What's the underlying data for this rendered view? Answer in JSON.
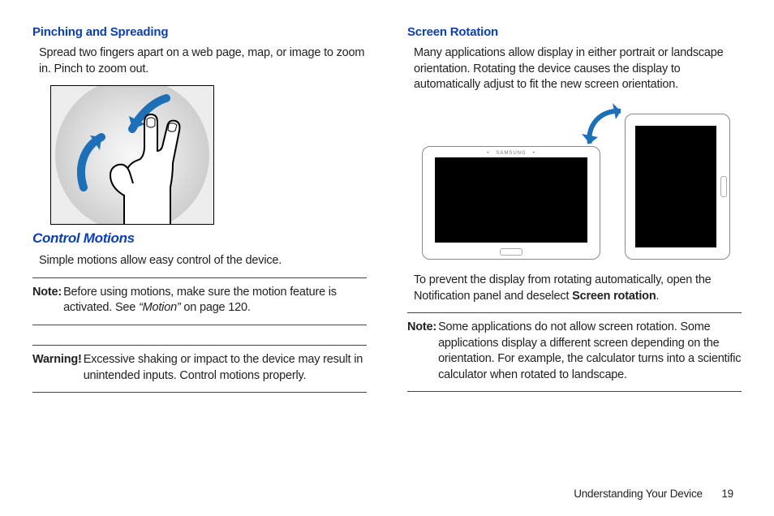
{
  "left": {
    "h_pinch": "Pinching and Spreading",
    "p_pinch": "Spread two fingers apart on a web page, map, or image to zoom in. Pinch to zoom out.",
    "h_control": "Control Motions",
    "p_control": "Simple motions allow easy control of the device.",
    "note_label": "Note:",
    "note_pre": "Before using motions, make sure the motion feature is activated. See ",
    "note_ref": "“Motion”",
    "note_post": " on page 120.",
    "warn_label": "Warning!",
    "warn_text": " Excessive shaking or impact to the device may result in unintended inputs. Control motions properly."
  },
  "right": {
    "h_rot": "Screen Rotation",
    "p_rot": "Many applications allow display in either portrait or landscape orientation. Rotating the device causes the display to automatically adjust to fit the new screen orientation.",
    "prevent_pre": "To prevent the display from rotating automatically, open the Notification panel and deselect ",
    "prevent_bold": "Screen rotation",
    "prevent_post": ".",
    "note_label": "Note:",
    "note_text": " Some applications do not allow screen rotation. Some applications display a different screen depending on the orientation. For example, the calculator turns into a scientific calculator when rotated to landscape."
  },
  "footer": {
    "section": "Understanding Your Device",
    "page": "19"
  },
  "brand": "SAMSUNG"
}
